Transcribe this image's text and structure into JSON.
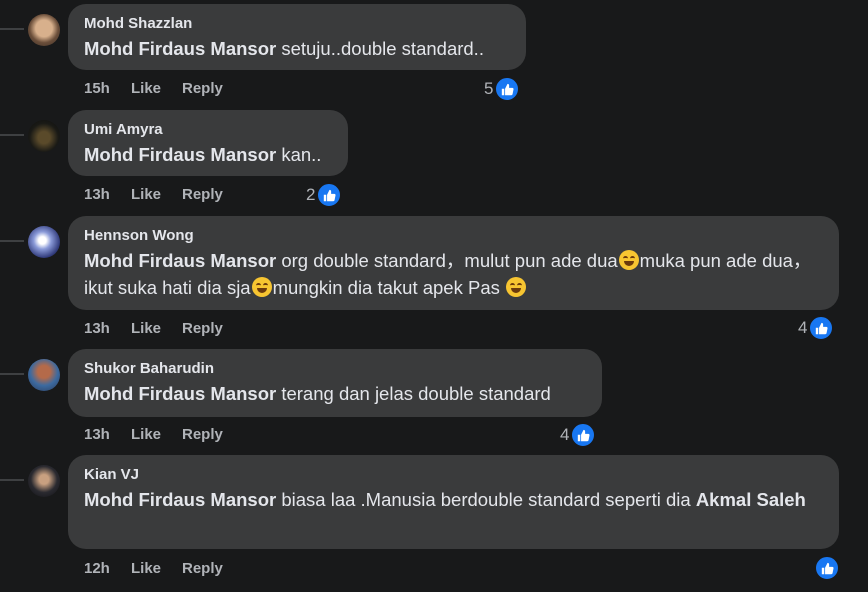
{
  "actions": {
    "like": "Like",
    "reply": "Reply"
  },
  "comments": [
    {
      "author": "Mohd Shazzlan",
      "mention": "Mohd Firdaus Mansor",
      "text": " setuju..double standard..",
      "time": "15h",
      "likes": "5"
    },
    {
      "author": "Umi Amyra",
      "mention": "Mohd Firdaus Mansor",
      "text": " kan..",
      "time": "13h",
      "likes": "2"
    },
    {
      "author": "Hennson Wong",
      "mention": "Mohd Firdaus Mansor",
      "text_a": " org double standard，mulut pun ade dua",
      "text_b": "muka pun ade dua， ikut suka hati dia sja",
      "text_c": "mungkin dia takut apek Pas ",
      "time": "13h",
      "likes": "4"
    },
    {
      "author": "Shukor Baharudin",
      "mention": "Mohd Firdaus Mansor",
      "text": " terang dan jelas double standard",
      "time": "13h",
      "likes": "4"
    },
    {
      "author": "Kian VJ",
      "mention": "Mohd Firdaus Mansor",
      "text": " biasa laa .Manusia berdouble standard seperti dia ",
      "mention2": "Akmal Saleh",
      "time": "12h",
      "likes": ""
    }
  ],
  "colors": {
    "background": "#18191a",
    "bubble": "#3a3b3c",
    "like": "#1877f2"
  }
}
